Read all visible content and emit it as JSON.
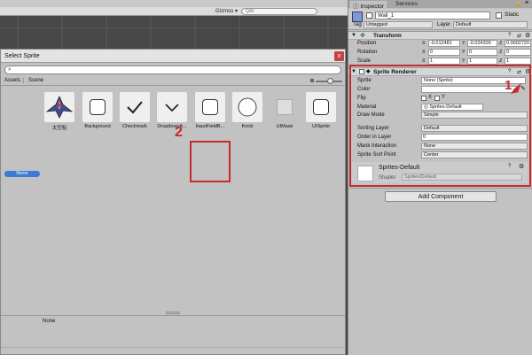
{
  "scene_toolbar": {
    "gizmos_label": "Gizmos ▾",
    "search_placeholder": "All"
  },
  "dialog": {
    "title": "Select Sprite",
    "close_label": "x",
    "tabs": [
      "Assets",
      "Scene"
    ],
    "items": [
      {
        "label": "None",
        "kind": "none"
      },
      {
        "label": "太空船",
        "kind": "ship"
      },
      {
        "label": "Background",
        "kind": "rounded"
      },
      {
        "label": "Checkmark",
        "kind": "check"
      },
      {
        "label": "DropdownA...",
        "kind": "chevron"
      },
      {
        "label": "InputFieldB...",
        "kind": "rounded-selected"
      },
      {
        "label": "Knob",
        "kind": "circle"
      },
      {
        "label": "UIMask",
        "kind": "plain"
      },
      {
        "label": "UISprite",
        "kind": "rounded"
      }
    ],
    "selected_preview": "None",
    "annotation": "2"
  },
  "inspector": {
    "tabs": [
      "Inspector",
      "Services"
    ],
    "object_name": "Wall_1",
    "static_label": "Static",
    "tag_label": "Tag",
    "tag_value": "Untagged",
    "layer_label": "Layer",
    "layer_value": "Default",
    "transform": {
      "title": "Transform",
      "rows": [
        {
          "label": "Position",
          "x": "-0.012481",
          "y": "-0.024326",
          "z": "0.0002720"
        },
        {
          "label": "Rotation",
          "x": "0",
          "y": "0",
          "z": "0"
        },
        {
          "label": "Scale",
          "x": "1",
          "y": "1",
          "z": "1"
        }
      ]
    },
    "sprite_renderer": {
      "title": "Sprite Renderer",
      "sprite_label": "Sprite",
      "sprite_value": "None (Sprite)",
      "color_label": "Color",
      "flip_label": "Flip",
      "flip_x": "X",
      "flip_y": "Y",
      "material_label": "Material",
      "material_value": "Sprites-Default",
      "draw_mode_label": "Draw Mode",
      "draw_mode_value": "Simple",
      "sorting_layer_label": "Sorting Layer",
      "sorting_layer_value": "Default",
      "order_label": "Order in Layer",
      "order_value": "0",
      "mask_label": "Mask Interaction",
      "mask_value": "None",
      "sort_point_label": "Sprite Sort Point",
      "sort_point_value": "Center"
    },
    "material": {
      "name": "Sprites-Default",
      "shader_label": "Shader",
      "shader_value": "Sprites/Default"
    },
    "add_component": "Add Component",
    "annotation": "1"
  },
  "colors": {
    "annotation_red": "#c6292f",
    "selection_blue": "#3e7ad6"
  }
}
